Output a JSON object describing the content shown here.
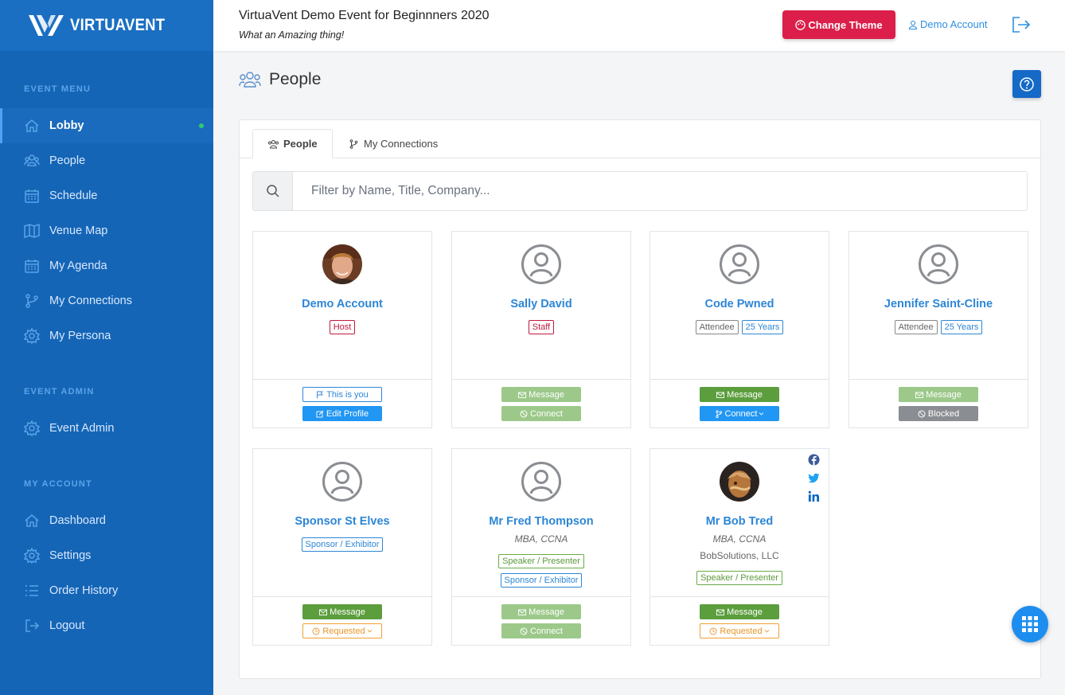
{
  "brand": {
    "name": "VIRTUAVENT"
  },
  "header": {
    "event_title": "VirtuaVent Demo Event for Beginnners 2020",
    "event_subtitle": "What an Amazing thing!",
    "theme_button": "Change Theme",
    "account_link": "Demo Account"
  },
  "sidebar": {
    "sections": [
      {
        "title": "EVENT MENU"
      },
      {
        "title": "EVENT ADMIN"
      },
      {
        "title": "MY ACCOUNT"
      }
    ],
    "items": [
      {
        "label": "Lobby",
        "icon": "home-icon"
      },
      {
        "label": "People",
        "icon": "people-icon"
      },
      {
        "label": "Schedule",
        "icon": "calendar-icon"
      },
      {
        "label": "Venue Map",
        "icon": "map-icon"
      },
      {
        "label": "My Agenda",
        "icon": "calendar-icon"
      },
      {
        "label": "My Connections",
        "icon": "branch-icon"
      },
      {
        "label": "My Persona",
        "icon": "gear-icon"
      },
      {
        "label": "Event Admin",
        "icon": "gear-icon"
      },
      {
        "label": "Dashboard",
        "icon": "home-icon"
      },
      {
        "label": "Settings",
        "icon": "gear-icon"
      },
      {
        "label": "Order History",
        "icon": "list-icon"
      },
      {
        "label": "Logout",
        "icon": "logout-icon"
      }
    ]
  },
  "page": {
    "title": "People",
    "tabs": [
      {
        "label": "People"
      },
      {
        "label": "My Connections"
      }
    ],
    "search_placeholder": "Filter by Name, Title, Company..."
  },
  "people": [
    {
      "name": "Demo Account",
      "badges": [
        "Host"
      ],
      "btn1": "This is you",
      "btn2": "Edit Profile"
    },
    {
      "name": "Sally David",
      "badges": [
        "Staff"
      ],
      "btn1": "Message",
      "btn2": "Connect"
    },
    {
      "name": "Code Pwned",
      "badges": [
        "Attendee",
        "25 Years"
      ],
      "btn1": "Message",
      "btn2": "Connect"
    },
    {
      "name": "Jennifer Saint-Cline",
      "badges": [
        "Attendee",
        "25 Years"
      ],
      "btn1": "Message",
      "btn2": "Blocked"
    },
    {
      "name": "Sponsor St Elves",
      "badges": [
        "Sponsor / Exhibitor"
      ],
      "btn1": "Message",
      "btn2": "Requested"
    },
    {
      "name": "Mr Fred Thompson",
      "title": "MBA, CCNA",
      "badges": [
        "Speaker / Presenter",
        "Sponsor / Exhibitor"
      ],
      "btn1": "Message",
      "btn2": "Connect"
    },
    {
      "name": "Mr Bob Tred",
      "title": "MBA, CCNA",
      "company": "BobSolutions, LLC",
      "badges": [
        "Speaker / Presenter"
      ],
      "btn1": "Message",
      "btn2": "Requested"
    }
  ]
}
